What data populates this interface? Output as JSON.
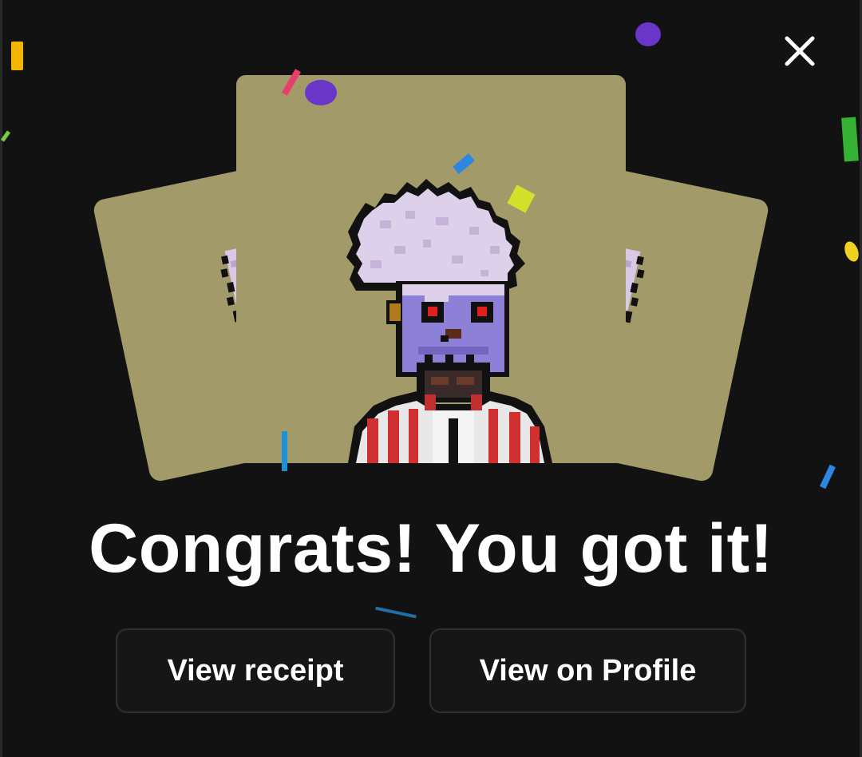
{
  "dialog": {
    "headline": "Congrats! You got it!",
    "close_icon": "close-icon"
  },
  "actions": {
    "view_receipt_label": "View receipt",
    "view_profile_label": "View on Profile"
  },
  "artwork": {
    "subject": "pixel-art character",
    "card_color": "#a39a6a"
  },
  "colors": {
    "background": "#121212",
    "button_bg": "#161616",
    "button_border": "#303030",
    "text": "#ffffff"
  }
}
